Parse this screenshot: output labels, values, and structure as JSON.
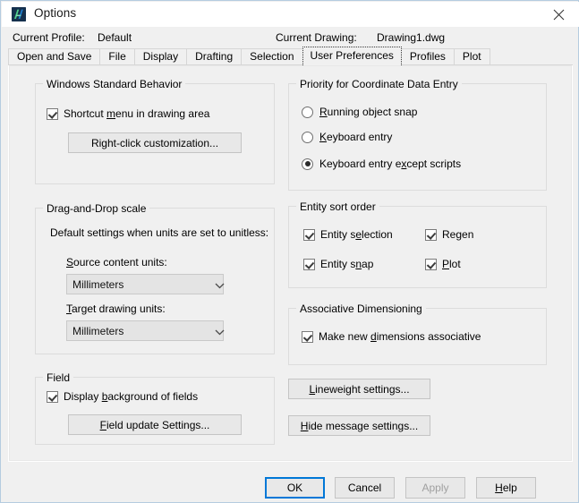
{
  "window": {
    "title": "Options",
    "icon": "autocad-app-icon",
    "close_icon": "close-icon"
  },
  "header": {
    "profile_label": "Current Profile:",
    "profile_value": "Default",
    "drawing_label": "Current Drawing:",
    "drawing_value": "Drawing1.dwg"
  },
  "tabs": [
    {
      "label": "Open and Save",
      "active": false
    },
    {
      "label": "File",
      "active": false
    },
    {
      "label": "Display",
      "active": false
    },
    {
      "label": "Drafting",
      "active": false
    },
    {
      "label": "Selection",
      "active": false
    },
    {
      "label": "User Preferences",
      "active": true
    },
    {
      "label": "Profiles",
      "active": false
    },
    {
      "label": "Plot",
      "active": false
    }
  ],
  "groups": {
    "windows_standard_behavior": {
      "title": "Windows Standard Behavior",
      "shortcut_menu": {
        "label": "Shortcut menu in drawing area",
        "checked": true,
        "mnemonic": "m"
      },
      "right_click_button": {
        "label": "Right-click customization...",
        "mnemonic": "g"
      }
    },
    "drag_and_drop_scale": {
      "title": "Drag-and-Drop scale",
      "description": "Default settings when units are set to unitless:",
      "source_units": {
        "label": "Source content units:",
        "mnemonic": "S",
        "value": "Millimeters"
      },
      "target_units": {
        "label": "Target drawing units:",
        "mnemonic": "T",
        "value": "Millimeters"
      }
    },
    "field": {
      "title": "Field",
      "display_background": {
        "label": "Display background of fields",
        "checked": true,
        "mnemonic": "b"
      },
      "field_update_button": {
        "label": "Field update Settings...",
        "mnemonic": "F"
      }
    },
    "priority_coordinate_data_entry": {
      "title": "Priority for Coordinate Data Entry",
      "options": [
        {
          "label": "Running object snap",
          "selected": false,
          "mnemonic": "R"
        },
        {
          "label": "Keyboard entry",
          "selected": false,
          "mnemonic": "K"
        },
        {
          "label": "Keyboard entry except scripts",
          "selected": true,
          "mnemonic": "x"
        }
      ]
    },
    "entity_sort_order": {
      "title": "Entity sort order",
      "items": [
        {
          "label": "Entity selection",
          "checked": true,
          "mnemonic": "e"
        },
        {
          "label": "Regen",
          "checked": true,
          "mnemonic": "g"
        },
        {
          "label": "Entity snap",
          "checked": true,
          "mnemonic": "n"
        },
        {
          "label": "Plot",
          "checked": true,
          "mnemonic": "P"
        }
      ]
    },
    "associative_dimensioning": {
      "title": "Associative Dimensioning",
      "make_associative": {
        "label": "Make new dimensions associative",
        "checked": true,
        "mnemonic": "d"
      }
    }
  },
  "side_buttons": {
    "lineweight": {
      "label": "Lineweight settings...",
      "mnemonic": "L"
    },
    "hide_message": {
      "label": "Hide message settings...",
      "mnemonic": "H"
    }
  },
  "footer": {
    "ok": {
      "label": "OK",
      "default": true,
      "enabled": true
    },
    "cancel": {
      "label": "Cancel",
      "enabled": true
    },
    "apply": {
      "label": "Apply",
      "enabled": false
    },
    "help": {
      "label": "Help",
      "enabled": true,
      "mnemonic": "H"
    }
  },
  "colors": {
    "dialog_bg": "#f0f0f0",
    "window_border": "#b5cce0",
    "accent_focus": "#0078d7",
    "group_border": "#dcdcdc",
    "disabled_text": "#a0a0a0"
  }
}
